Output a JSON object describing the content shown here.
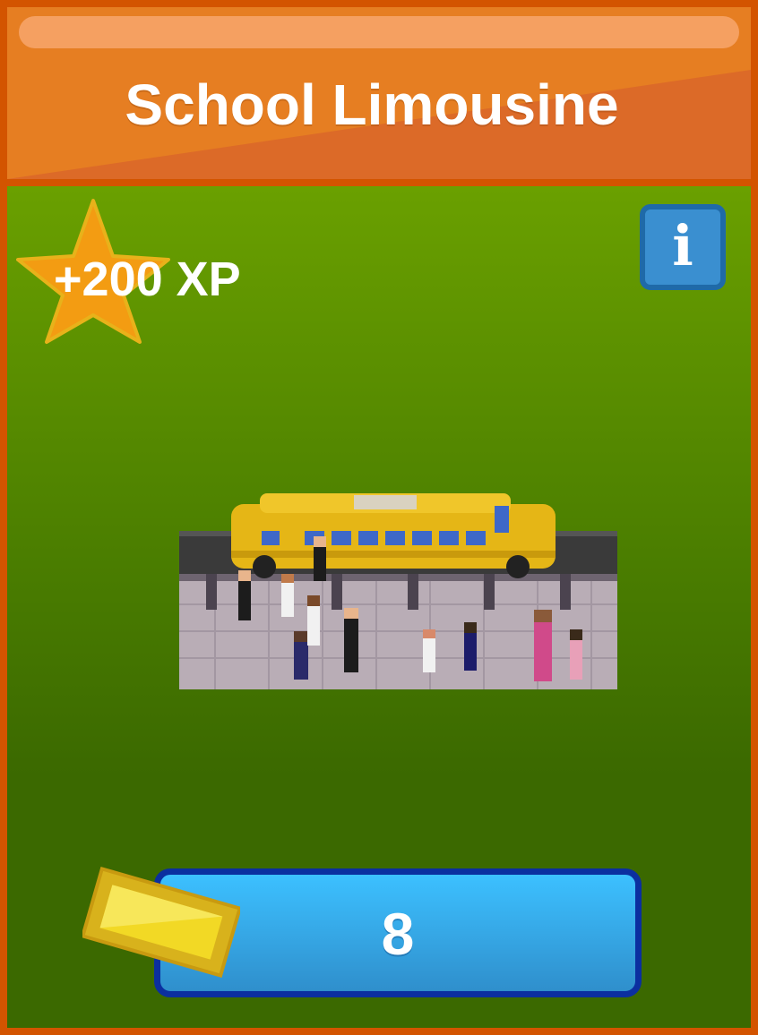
{
  "item": {
    "title": "School Limousine",
    "xp_reward": "+200 XP",
    "info_icon": "info-icon",
    "price": "8",
    "currency_icon": "gold-ticket-icon",
    "image": "school-limousine-pixel-art"
  },
  "colors": {
    "frame": "#d35400",
    "header": "#e67e22",
    "body_top": "#6aa000",
    "body_bottom": "#3b6900",
    "star": "#f39c12",
    "info_button": "#3a8fd0",
    "price_button": "#36a8e6",
    "price_border": "#0b2fa0",
    "ticket": "#e6c619"
  }
}
